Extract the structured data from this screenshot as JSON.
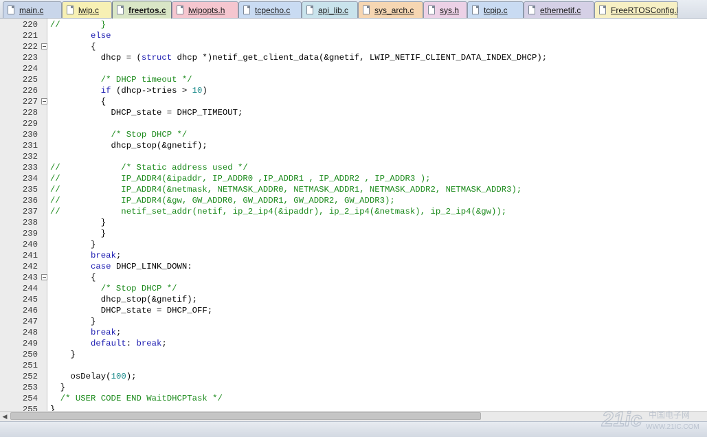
{
  "tabs": [
    {
      "label": "main.c",
      "color": "#c9d6ea",
      "active": false
    },
    {
      "label": "lwip.c",
      "color": "#f7f0b4",
      "active": false
    },
    {
      "label": "freertos.c",
      "color": "#d9e6c6",
      "active": true
    },
    {
      "label": "lwipopts.h",
      "color": "#f5c6cf",
      "active": false
    },
    {
      "label": "tcpecho.c",
      "color": "#c9dbf2",
      "active": false
    },
    {
      "label": "api_lib.c",
      "color": "#c9e3ec",
      "active": false
    },
    {
      "label": "sys_arch.c",
      "color": "#f6d6b2",
      "active": false
    },
    {
      "label": "sys.h",
      "color": "#ecd1e6",
      "active": false
    },
    {
      "label": "tcpip.c",
      "color": "#c9dbf2",
      "active": false
    },
    {
      "label": "ethernetif.c",
      "color": "#d5d0e6",
      "active": false
    },
    {
      "label": "FreeRTOSConfig.h",
      "color": "#f7f0c4",
      "active": false
    }
  ],
  "editor": {
    "lines": [
      {
        "num": "220",
        "fold": false,
        "html": "<span class=\"cm\">//        }</span>"
      },
      {
        "num": "221",
        "fold": false,
        "html": "        <span class=\"kw\">else</span>"
      },
      {
        "num": "222",
        "fold": true,
        "html": "        {"
      },
      {
        "num": "223",
        "fold": false,
        "html": "          dhcp = (<span class=\"kw\">struct</span> dhcp *)netif_get_client_data(&amp;gnetif, LWIP_NETIF_CLIENT_DATA_INDEX_DHCP);"
      },
      {
        "num": "224",
        "fold": false,
        "html": ""
      },
      {
        "num": "225",
        "fold": false,
        "html": "          <span class=\"cm\">/* DHCP timeout */</span>"
      },
      {
        "num": "226",
        "fold": false,
        "html": "          <span class=\"kw\">if</span> (dhcp-&gt;tries &gt; <span class=\"num\">10</span>)"
      },
      {
        "num": "227",
        "fold": true,
        "html": "          {"
      },
      {
        "num": "228",
        "fold": false,
        "html": "            DHCP_state = DHCP_TIMEOUT;"
      },
      {
        "num": "229",
        "fold": false,
        "html": ""
      },
      {
        "num": "230",
        "fold": false,
        "html": "            <span class=\"cm\">/* Stop DHCP */</span>"
      },
      {
        "num": "231",
        "fold": false,
        "html": "            dhcp_stop(&amp;gnetif);"
      },
      {
        "num": "232",
        "fold": false,
        "html": ""
      },
      {
        "num": "233",
        "fold": false,
        "html": "<span class=\"cm\">//            /* Static address used */</span>"
      },
      {
        "num": "234",
        "fold": false,
        "html": "<span class=\"cm\">//            IP_ADDR4(&amp;ipaddr, IP_ADDR0 ,IP_ADDR1 , IP_ADDR2 , IP_ADDR3 );</span>"
      },
      {
        "num": "235",
        "fold": false,
        "html": "<span class=\"cm\">//            IP_ADDR4(&amp;netmask, NETMASK_ADDR0, NETMASK_ADDR1, NETMASK_ADDR2, NETMASK_ADDR3);</span>"
      },
      {
        "num": "236",
        "fold": false,
        "html": "<span class=\"cm\">//            IP_ADDR4(&amp;gw, GW_ADDR0, GW_ADDR1, GW_ADDR2, GW_ADDR3);</span>"
      },
      {
        "num": "237",
        "fold": false,
        "html": "<span class=\"cm\">//            netif_set_addr(netif, ip_2_ip4(&amp;ipaddr), ip_2_ip4(&amp;netmask), ip_2_ip4(&amp;gw));</span>"
      },
      {
        "num": "238",
        "fold": false,
        "html": "          }"
      },
      {
        "num": "239",
        "fold": false,
        "html": "          }"
      },
      {
        "num": "240",
        "fold": false,
        "html": "        }"
      },
      {
        "num": "241",
        "fold": false,
        "html": "        <span class=\"kw\">break</span>;"
      },
      {
        "num": "242",
        "fold": false,
        "html": "        <span class=\"kw\">case</span> DHCP_LINK_DOWN:"
      },
      {
        "num": "243",
        "fold": true,
        "html": "        {"
      },
      {
        "num": "244",
        "fold": false,
        "html": "          <span class=\"cm\">/* Stop DHCP */</span>"
      },
      {
        "num": "245",
        "fold": false,
        "html": "          dhcp_stop(&amp;gnetif);"
      },
      {
        "num": "246",
        "fold": false,
        "html": "          DHCP_state = DHCP_OFF;"
      },
      {
        "num": "247",
        "fold": false,
        "html": "        }"
      },
      {
        "num": "248",
        "fold": false,
        "html": "        <span class=\"kw\">break</span>;"
      },
      {
        "num": "249",
        "fold": false,
        "html": "        <span class=\"kw\">default</span>: <span class=\"kw\">break</span>;"
      },
      {
        "num": "250",
        "fold": false,
        "html": "    }"
      },
      {
        "num": "251",
        "fold": false,
        "html": ""
      },
      {
        "num": "252",
        "fold": false,
        "html": "    osDelay(<span class=\"num\">100</span>);"
      },
      {
        "num": "253",
        "fold": false,
        "html": "  }"
      },
      {
        "num": "254",
        "fold": false,
        "html": "  <span class=\"cm\">/* USER CODE END WaitDHCPTask */</span>"
      },
      {
        "num": "255",
        "fold": false,
        "html": "}"
      }
    ]
  },
  "colors": {
    "keyword": "#1a1ab0",
    "comment": "#1b8a1b",
    "number": "#1a8a8a",
    "gutter": "#ececec"
  },
  "watermark": {
    "logo_text": "21ic",
    "cn_text": "中国电子网",
    "sub_text": "WWW.21IC.COM"
  }
}
